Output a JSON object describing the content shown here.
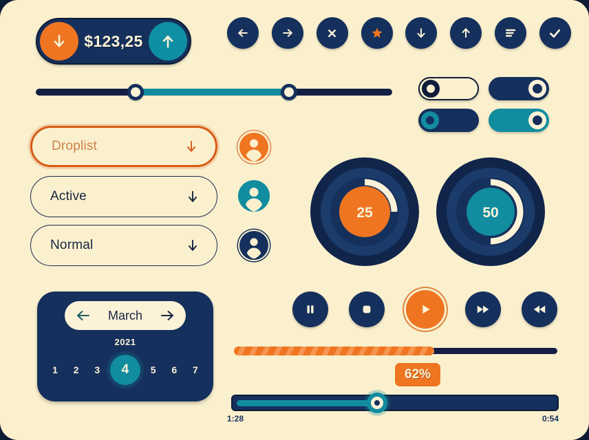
{
  "theme": {
    "background": "#FAF0CE",
    "navy": "#15305c",
    "navy_dark": "#0d1b33",
    "orange": "#EF7521",
    "orange_dark": "#D65B16",
    "teal": "#128C9F",
    "cream": "#FBF2D8"
  },
  "currency_widget": {
    "amount": "$123,25",
    "decrease_icon": "arrow-down-icon",
    "increase_icon": "arrow-up-icon"
  },
  "icon_row": [
    {
      "name": "arrow-left-icon",
      "label": "Back"
    },
    {
      "name": "arrow-right-icon",
      "label": "Forward"
    },
    {
      "name": "close-icon",
      "label": "Close"
    },
    {
      "name": "star-icon",
      "label": "Favorite"
    },
    {
      "name": "arrow-down-icon",
      "label": "Download"
    },
    {
      "name": "arrow-up-icon",
      "label": "Upload"
    },
    {
      "name": "menu-icon",
      "label": "Menu"
    },
    {
      "name": "check-icon",
      "label": "Confirm"
    }
  ],
  "range_slider": {
    "low_percent": 28,
    "high_percent": 71,
    "knob_icon": "slider-knob"
  },
  "toggles": [
    {
      "name": "toggle-outline-off",
      "state": "off",
      "style": "outline"
    },
    {
      "name": "toggle-navy-on",
      "state": "on",
      "style": "navy"
    },
    {
      "name": "toggle-navy-off",
      "state": "off",
      "style": "navy-teal-knob"
    },
    {
      "name": "toggle-teal-on",
      "state": "on",
      "style": "teal"
    }
  ],
  "dropdowns": [
    {
      "label": "Droplist",
      "state": "focused",
      "icon": "chevron-down-icon"
    },
    {
      "label": "Active",
      "state": "default",
      "icon": "chevron-down-icon"
    },
    {
      "label": "Normal",
      "state": "default",
      "icon": "chevron-down-icon"
    }
  ],
  "avatars": [
    {
      "name": "avatar-orange",
      "color": "#EF7521",
      "ring": true
    },
    {
      "name": "avatar-teal",
      "color": "#128C9F",
      "ring": false
    },
    {
      "name": "avatar-navy",
      "color": "#15305c",
      "ring": true
    }
  ],
  "dials": [
    {
      "name": "dial-25",
      "value": "25",
      "percent": 25,
      "color": "#EF7521"
    },
    {
      "name": "dial-50",
      "value": "50",
      "percent": 50,
      "color": "#128C9F"
    }
  ],
  "calendar": {
    "month": "March",
    "year": "2021",
    "prev_icon": "arrow-left-icon",
    "next_icon": "arrow-right-icon",
    "days": [
      "1",
      "2",
      "3",
      "4",
      "5",
      "6",
      "7"
    ],
    "selected_day": "4"
  },
  "media_controls": [
    {
      "name": "pause-button",
      "icon": "pause-icon"
    },
    {
      "name": "stop-button",
      "icon": "stop-icon"
    },
    {
      "name": "play-button",
      "icon": "play-icon"
    },
    {
      "name": "forward-button",
      "icon": "forward-icon"
    },
    {
      "name": "rewind-button",
      "icon": "rewind-icon"
    }
  ],
  "progress": {
    "percent": 62,
    "badge_label": "62%"
  },
  "scrubber": {
    "percent": 44,
    "current_time": "1:28",
    "total_time": "0:54"
  }
}
